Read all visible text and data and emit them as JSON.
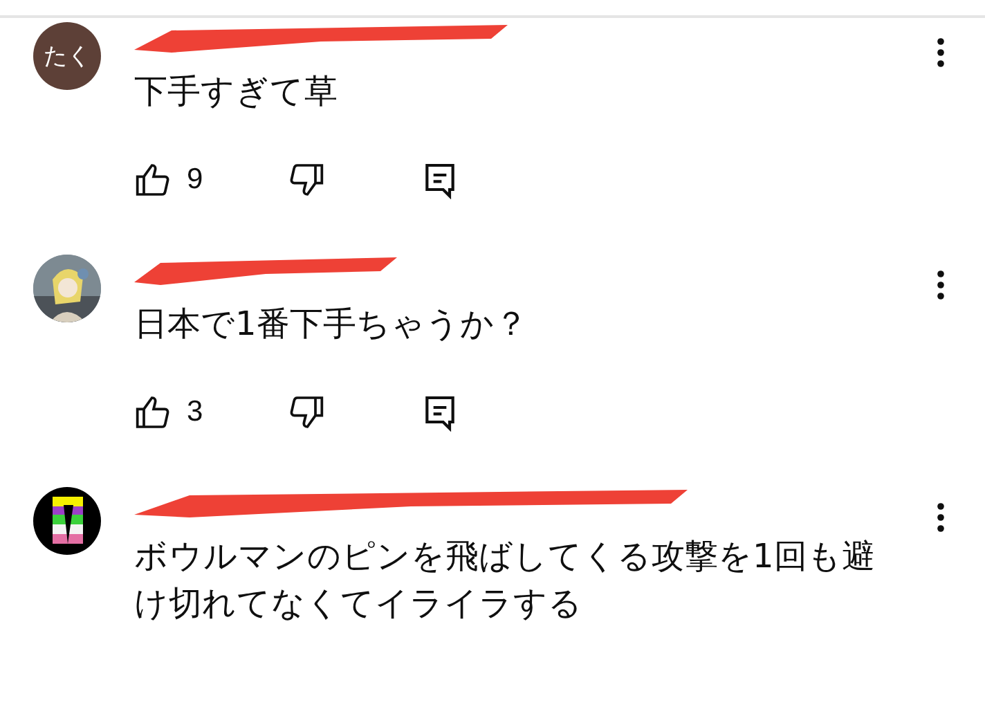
{
  "comments": [
    {
      "avatar": {
        "kind": "initials",
        "text": "たく",
        "color": "#5d4037"
      },
      "text": "下手すぎて草",
      "likes": "9"
    },
    {
      "text": "日本で1番下手ちゃうか？",
      "likes": "3"
    },
    {
      "avatar": {
        "kind": "logo"
      },
      "text": "ボウルマンのピンを飛ばしてくる攻撃を1回も避け切れてなくてイライラする"
    }
  ]
}
